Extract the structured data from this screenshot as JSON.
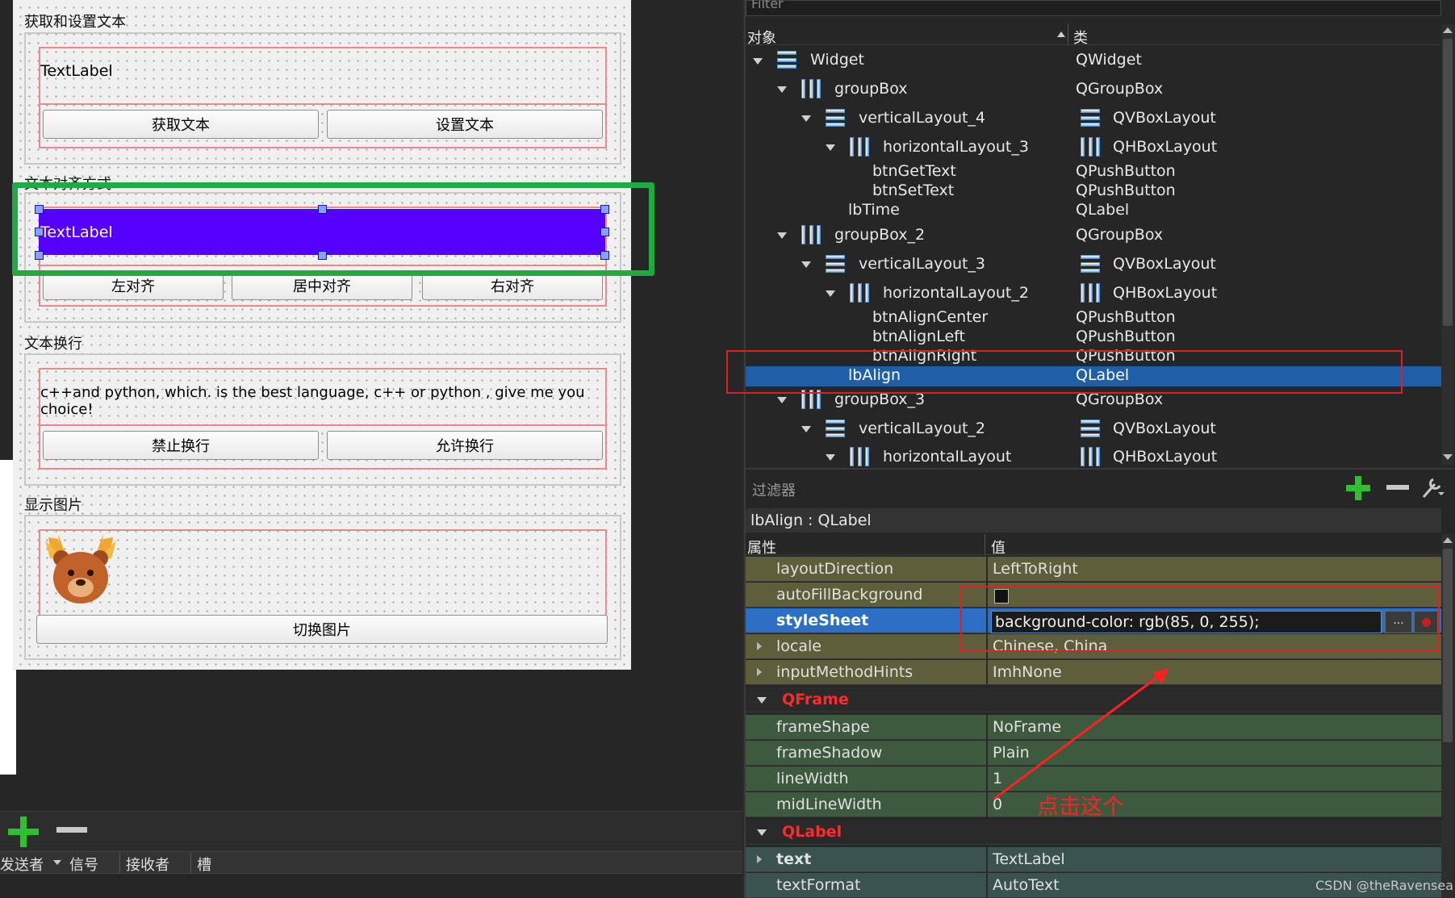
{
  "form": {
    "group1": {
      "title": "获取和设置文本",
      "label": "TextLabel",
      "btn_get": "获取文本",
      "btn_set": "设置文本"
    },
    "group2": {
      "title": "文本对齐方式",
      "label": "TextLabel",
      "btn_left": "左对齐",
      "btn_center": "居中对齐",
      "btn_right": "右对齐",
      "label_bg": "#5500ff"
    },
    "group3": {
      "title": "文本换行",
      "label": "c++and python, which. is the best language, c++ or python , give me you choice!",
      "btn_nowrap": "禁止换行",
      "btn_wrap": "允许换行"
    },
    "group4": {
      "title": "显示图片",
      "btn_switch": "切换图片",
      "image_icon": "bear-moose-icon"
    }
  },
  "signal_slot": {
    "headers": [
      "发送者",
      "信号",
      "接收者",
      "槽"
    ]
  },
  "object_tree": {
    "filter_placeholder": "Filter",
    "col_object": "对象",
    "col_class": "类",
    "rows": [
      {
        "name": "Widget",
        "cls": "QWidget"
      },
      {
        "name": "groupBox",
        "cls": "QGroupBox"
      },
      {
        "name": "verticalLayout_4",
        "cls": "QVBoxLayout"
      },
      {
        "name": "horizontalLayout_3",
        "cls": "QHBoxLayout"
      },
      {
        "name": "btnGetText",
        "cls": "QPushButton"
      },
      {
        "name": "btnSetText",
        "cls": "QPushButton"
      },
      {
        "name": "lbTime",
        "cls": "QLabel"
      },
      {
        "name": "groupBox_2",
        "cls": "QGroupBox"
      },
      {
        "name": "verticalLayout_3",
        "cls": "QVBoxLayout"
      },
      {
        "name": "horizontalLayout_2",
        "cls": "QHBoxLayout"
      },
      {
        "name": "btnAlignCenter",
        "cls": "QPushButton"
      },
      {
        "name": "btnAlignLeft",
        "cls": "QPushButton"
      },
      {
        "name": "btnAlignRight",
        "cls": "QPushButton"
      },
      {
        "name": "lbAlign",
        "cls": "QLabel"
      },
      {
        "name": "groupBox_3",
        "cls": "QGroupBox"
      },
      {
        "name": "verticalLayout_2",
        "cls": "QVBoxLayout"
      },
      {
        "name": "horizontalLayout",
        "cls": "QHBoxLayout"
      }
    ]
  },
  "property_editor": {
    "filter_placeholder": "过滤器",
    "object_class": "lbAlign : QLabel",
    "col_property": "属性",
    "col_value": "值",
    "rows": [
      {
        "key": "layoutDirection",
        "value": "LeftToRight"
      },
      {
        "key": "autoFillBackground",
        "value": ""
      },
      {
        "key": "styleSheet",
        "value": "background-color: rgb(85, 0, 255);"
      },
      {
        "key": "locale",
        "value": "Chinese, China"
      },
      {
        "key": "inputMethodHints",
        "value": "ImhNone"
      },
      {
        "key": "QFrame",
        "value": ""
      },
      {
        "key": "frameShape",
        "value": "NoFrame"
      },
      {
        "key": "frameShadow",
        "value": "Plain"
      },
      {
        "key": "lineWidth",
        "value": "1"
      },
      {
        "key": "midLineWidth",
        "value": "0"
      },
      {
        "key": "QLabel",
        "value": ""
      },
      {
        "key": "text",
        "value": "TextLabel"
      },
      {
        "key": "textFormat",
        "value": "AutoText"
      }
    ],
    "dots_label": "..."
  },
  "annotation": "点击这个",
  "watermark": "CSDN @theRavensea"
}
